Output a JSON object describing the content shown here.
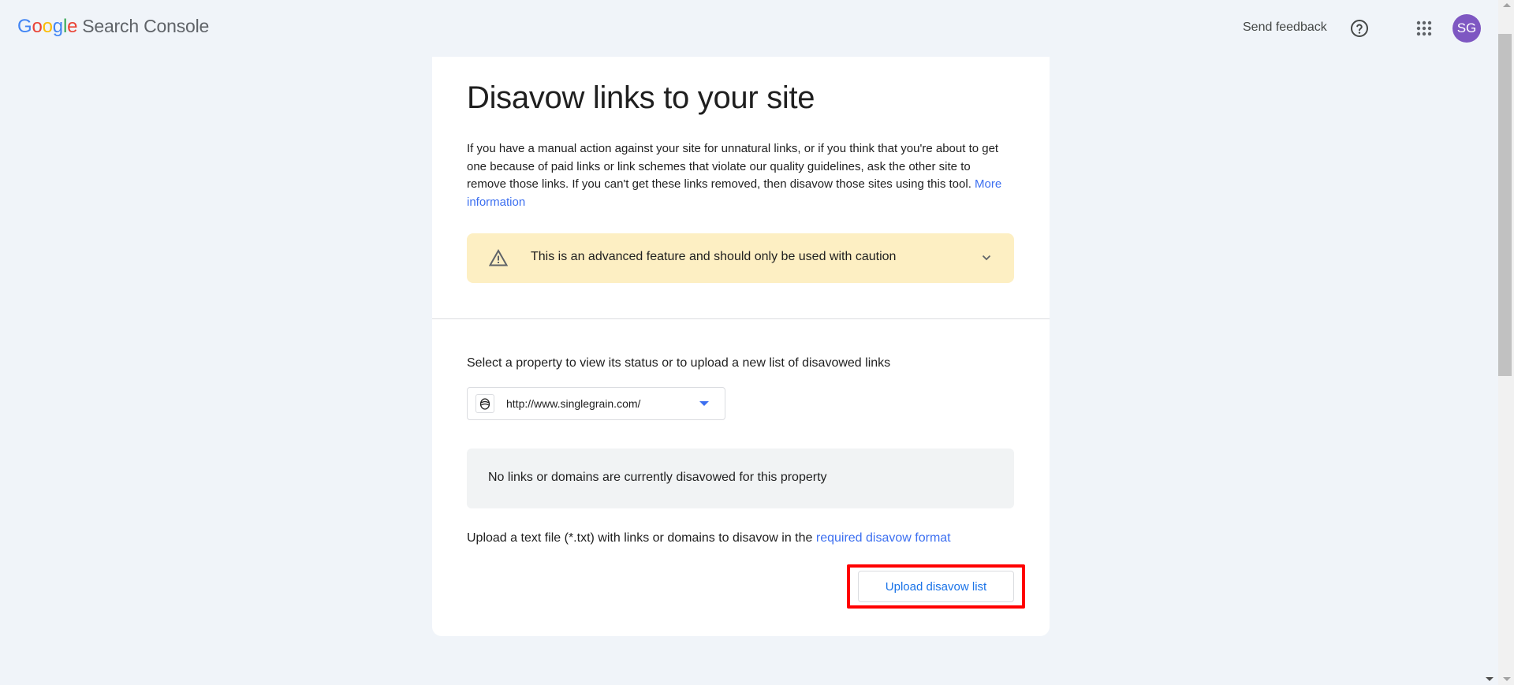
{
  "header": {
    "logo_google": [
      "G",
      "o",
      "o",
      "g",
      "l",
      "e"
    ],
    "product_name": "Search Console",
    "send_feedback": "Send feedback",
    "help_icon": "help-circle-icon",
    "apps_icon": "apps-grid-icon",
    "avatar_initials": "SG",
    "avatar_color": "#7e57c2"
  },
  "page": {
    "title": "Disavow links to your site",
    "intro_text": "If you have a manual action against your site for unnatural links, or if you think that you're about to get one because of paid links or link schemes that violate our quality guidelines, ask the other site to remove those links. If you can't get these links removed, then disavow those sites using this tool.",
    "intro_link": "More information",
    "warning": {
      "icon": "warning-triangle-icon",
      "text": "This is an advanced feature and should only be used with caution",
      "expand_icon": "chevron-down-icon",
      "background": "#fdefc3"
    },
    "select_label": "Select a property to view its status or to upload a new list of disavowed links",
    "property_select": {
      "value": "http://www.singlegrain.com/",
      "icon": "site-favicon-icon"
    },
    "status_message": "No links or domains are currently disavowed for this property",
    "upload_instruction": "Upload a text file (*.txt) with links or domains to disavow in the",
    "upload_instruction_link": "required disavow format",
    "upload_button": "Upload disavow list",
    "highlight_color": "#ff0000"
  }
}
